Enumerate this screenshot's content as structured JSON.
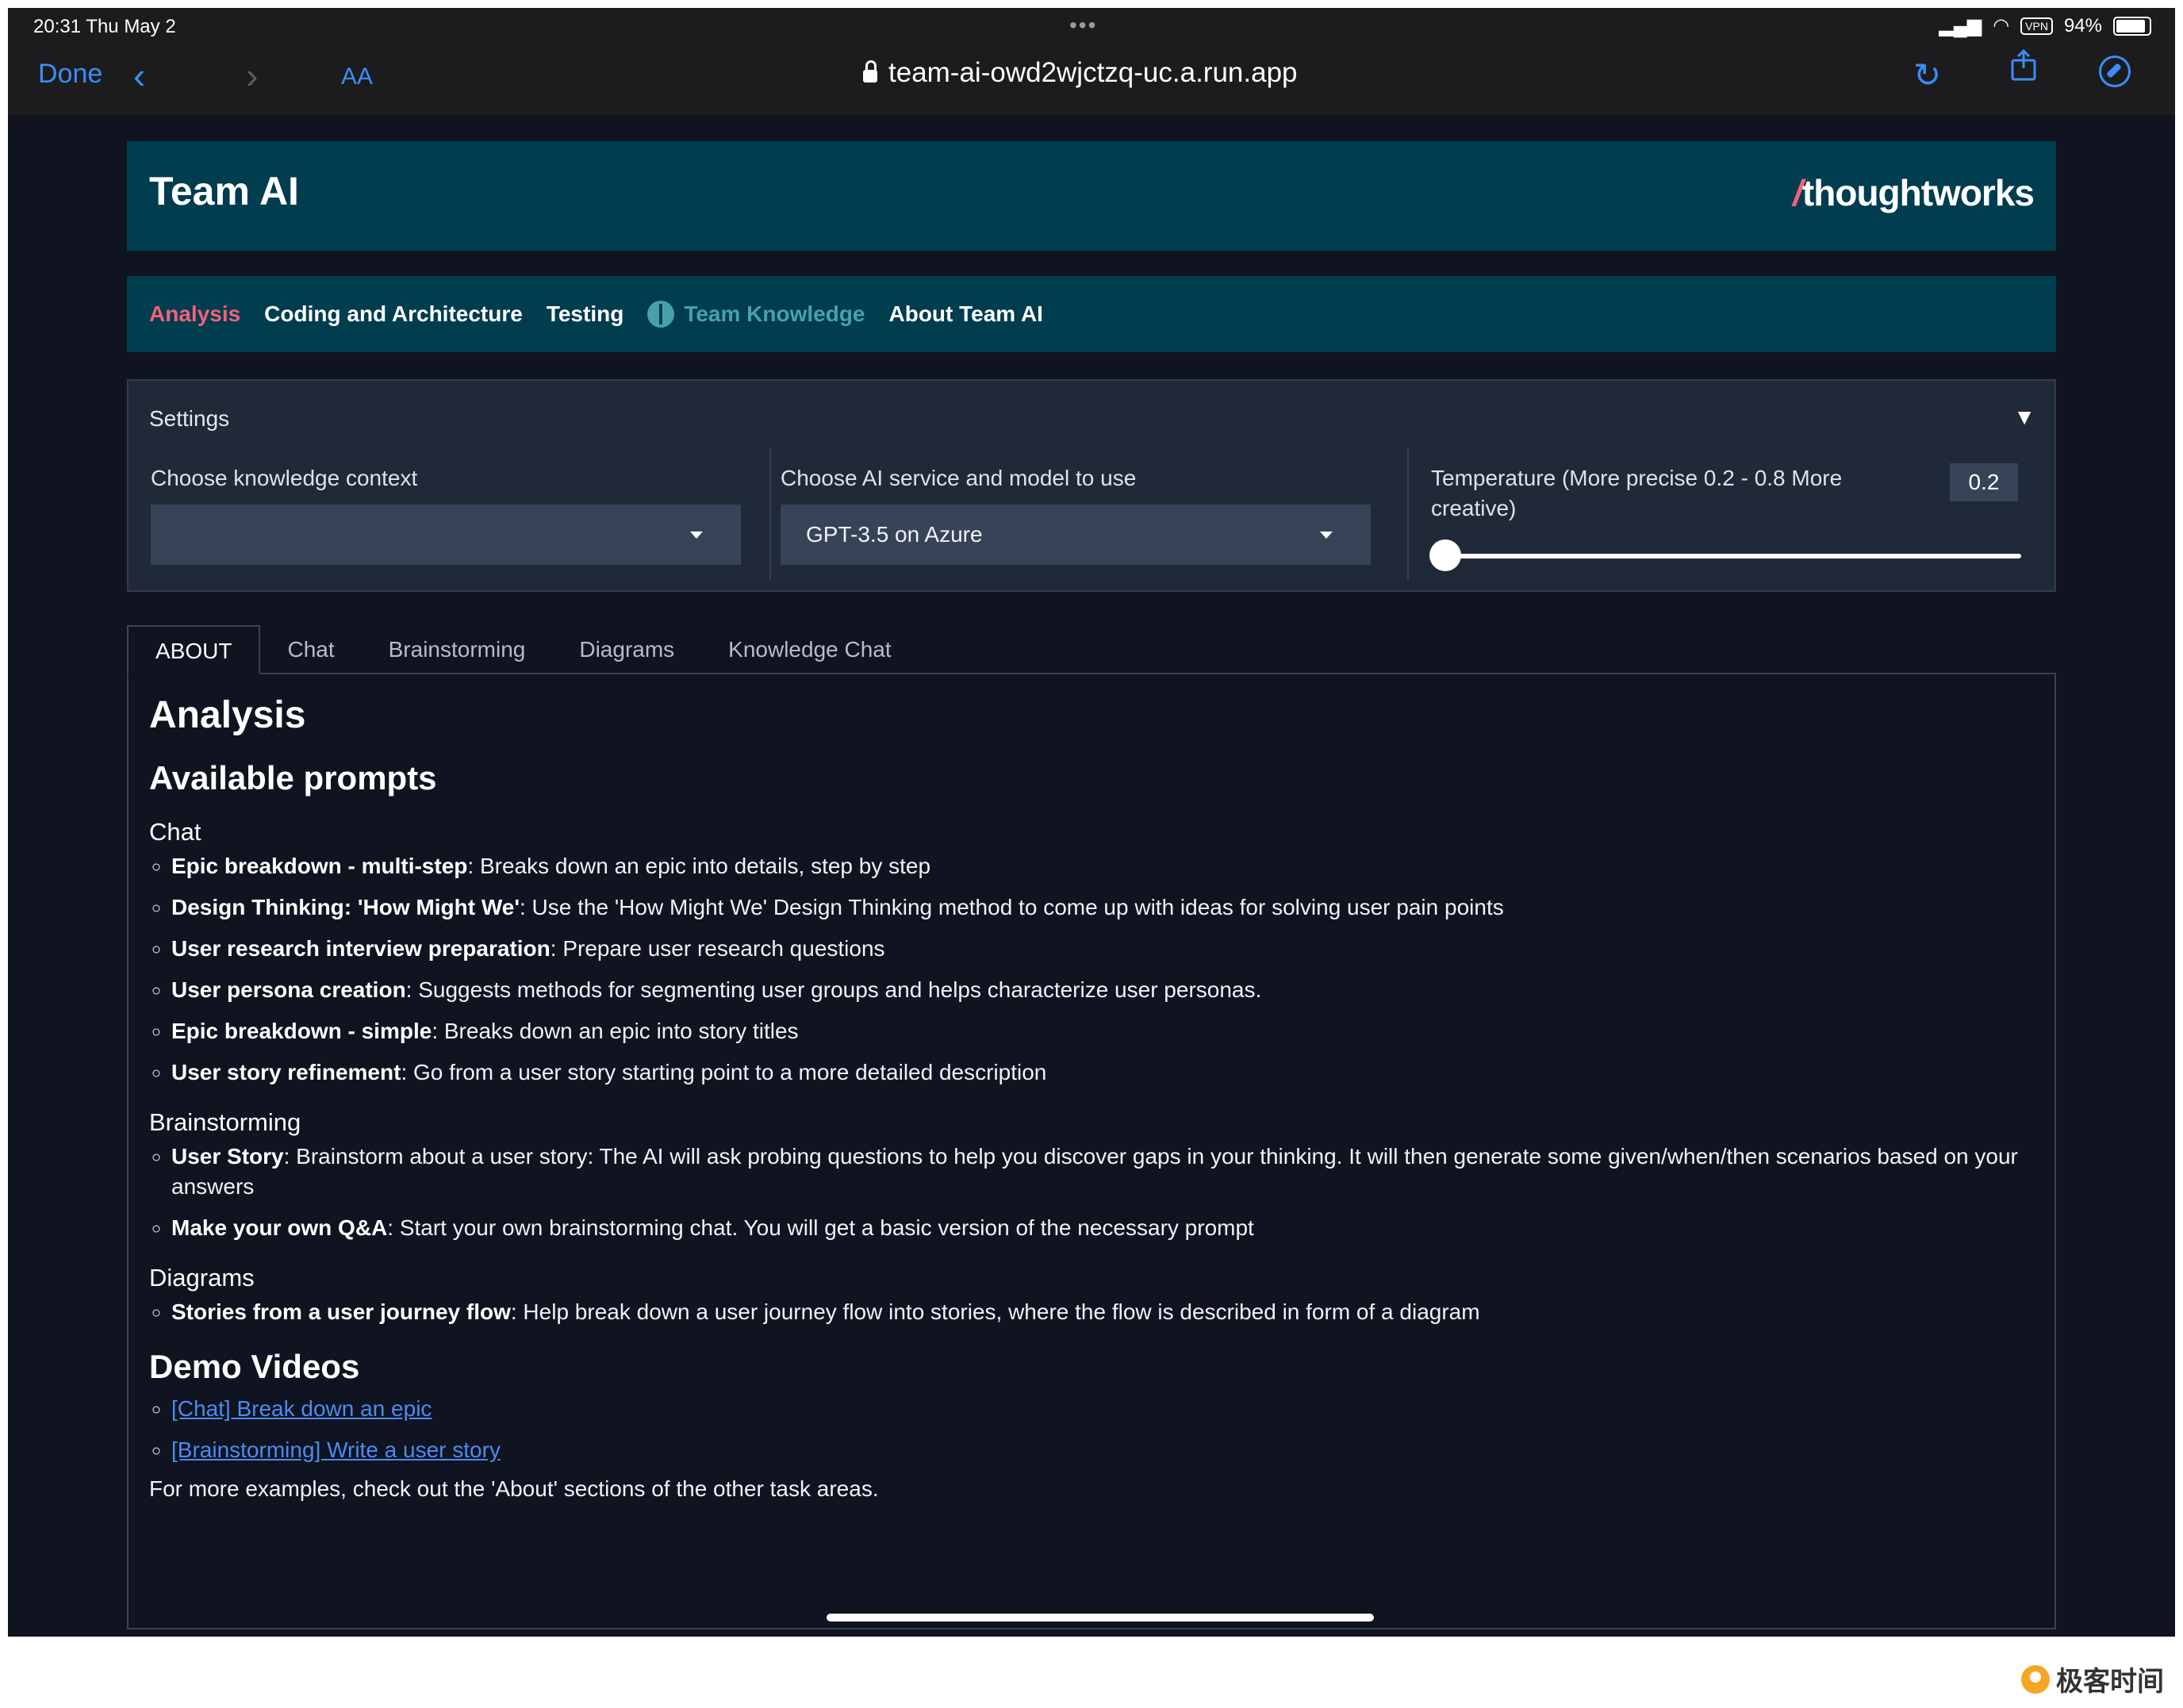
{
  "status": {
    "time": "20:31  Thu May 2",
    "dots": "•••",
    "vpn": "VPN",
    "battery": "94%"
  },
  "browser": {
    "done": "Done",
    "back": "‹",
    "forward": "›",
    "aa": "AA",
    "url": "team-ai-owd2wjctzq-uc.a.run.app",
    "reload": "↻"
  },
  "app": {
    "title": "Team AI",
    "logo_slash": "/",
    "logo_text": "thoughtworks"
  },
  "nav": {
    "analysis": "Analysis",
    "coding": "Coding and Architecture",
    "testing": "Testing",
    "knowledge": "Team Knowledge",
    "about": "About Team AI"
  },
  "settings": {
    "title": "Settings",
    "toggle": "▼",
    "knowledge_label": "Choose knowledge context",
    "knowledge_value": "",
    "model_label": "Choose AI service and model to use",
    "model_value": "GPT-3.5 on Azure",
    "temp_label": "Temperature (More precise 0.2 - 0.8 More creative)",
    "temp_value": "0.2"
  },
  "tabs": [
    "ABOUT",
    "Chat",
    "Brainstorming",
    "Diagrams",
    "Knowledge Chat"
  ],
  "content": {
    "title": "Analysis",
    "subtitle": "Available prompts",
    "chat_heading": "Chat",
    "chat_items": [
      {
        "name": "Epic breakdown - multi-step",
        "desc": ": Breaks down an epic into details, step by step"
      },
      {
        "name": "Design Thinking: 'How Might We'",
        "desc": ": Use the 'How Might We' Design Thinking method to come up with ideas for solving user pain points"
      },
      {
        "name": "User research interview preparation",
        "desc": ": Prepare user research questions"
      },
      {
        "name": "User persona creation",
        "desc": ": Suggests methods for segmenting user groups and helps characterize user personas."
      },
      {
        "name": "Epic breakdown - simple",
        "desc": ": Breaks down an epic into story titles"
      },
      {
        "name": "User story refinement",
        "desc": ": Go from a user story starting point to a more detailed description"
      }
    ],
    "brain_heading": "Brainstorming",
    "brain_items": [
      {
        "name": "User Story",
        "desc": ": Brainstorm about a user story: The AI will ask probing questions to help you discover gaps in your thinking. It will then generate some given/when/then scenarios based on your answers"
      },
      {
        "name": "Make your own Q&A",
        "desc": ": Start your own brainstorming chat. You will get a basic version of the necessary prompt"
      }
    ],
    "diag_heading": "Diagrams",
    "diag_items": [
      {
        "name": "Stories from a user journey flow",
        "desc": ": Help break down a user journey flow into stories, where the flow is described in form of a diagram"
      }
    ],
    "demo_heading": "Demo Videos",
    "demo_links": [
      "[Chat] Break down an epic",
      "[Brainstorming] Write a user story"
    ],
    "more": "For more examples, check out the 'About' sections of the other task areas."
  },
  "watermark": "极客时间",
  "colors": {
    "header_bg": "#003d4f",
    "accent": "#f2617a",
    "knowledge": "#47a1ad",
    "link": "#4d8af0"
  }
}
